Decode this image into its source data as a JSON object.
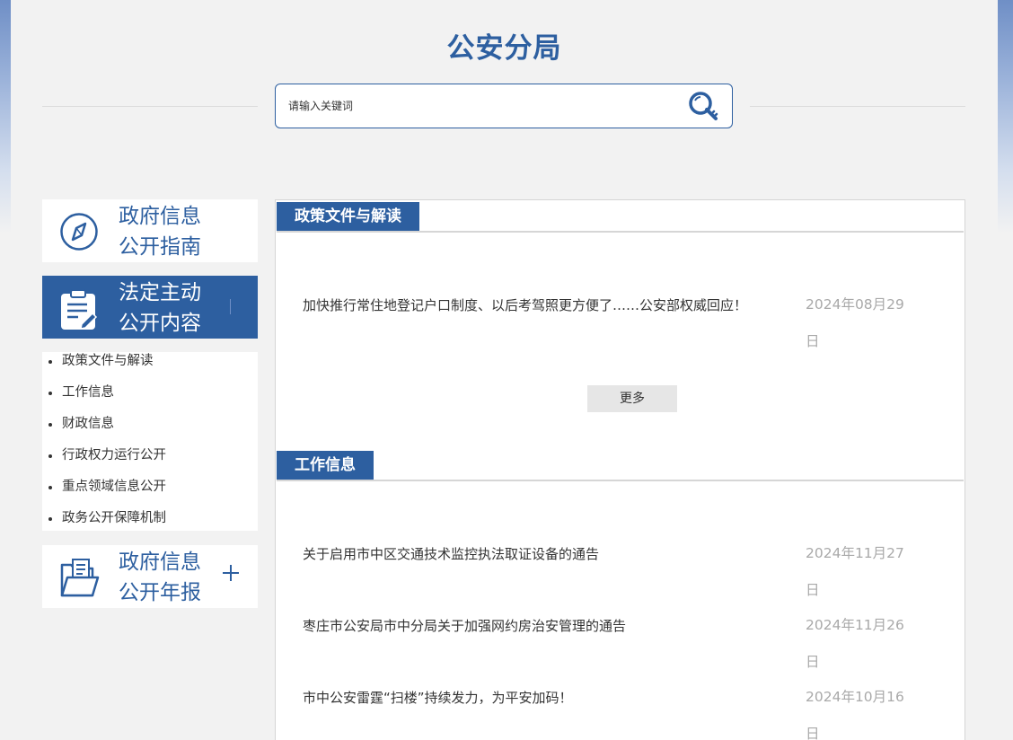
{
  "site": {
    "title": "公安分局"
  },
  "search": {
    "placeholder": "请输入关键词"
  },
  "sidebar": {
    "guide": {
      "line1": "政府信息",
      "line2": "公开指南"
    },
    "active": {
      "line1": "法定主动",
      "line2": "公开内容"
    },
    "sub_items": [
      {
        "label": "政策文件与解读"
      },
      {
        "label": "工作信息"
      },
      {
        "label": "财政信息"
      },
      {
        "label": "行政权力运行公开"
      },
      {
        "label": "重点领域信息公开"
      },
      {
        "label": "政务公开保障机制"
      }
    ],
    "report": {
      "line1": "政府信息",
      "line2": "公开年报"
    }
  },
  "sections": {
    "policy": {
      "title": "政策文件与解读",
      "items": [
        {
          "title": "加快推行常住地登记户口制度、以后考驾照更方便了……公安部权威回应！",
          "date": "2024年08月29日"
        }
      ],
      "more_label": "更多"
    },
    "work": {
      "title": "工作信息",
      "items": [
        {
          "title": "关于启用市中区交通技术监控执法取证设备的通告",
          "date": "2024年11月27日"
        },
        {
          "title": "枣庄市公安局市中分局关于加强网约房治安管理的通告",
          "date": "2024年11月26日"
        },
        {
          "title": "市中公安雷霆“扫楼”持续发力，为平安加码！",
          "date": "2024年10月16日"
        }
      ]
    }
  },
  "colors": {
    "brand": "#2d5fa0",
    "date_gray": "#a9a9a9",
    "page_bg": "#f2f2f2"
  },
  "icons": {
    "search": "magnifier-key-icon",
    "guide": "compass-icon",
    "active": "clipboard-pen-icon",
    "report": "folder-documents-icon",
    "expand": "plus-icon"
  }
}
